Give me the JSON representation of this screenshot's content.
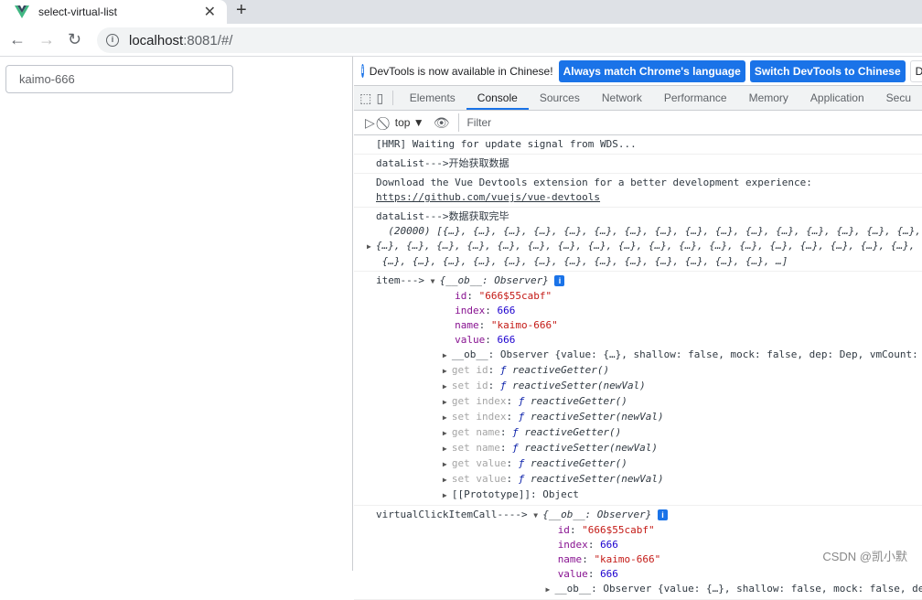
{
  "browser": {
    "tab_title": "select-virtual-list",
    "url_host": "localhost",
    "url_path": ":8081/#/"
  },
  "page": {
    "input_value": "kaimo-666"
  },
  "devtools": {
    "info_message": "DevTools is now available in Chinese!",
    "btn_match": "Always match Chrome's language",
    "btn_switch": "Switch DevTools to Chinese",
    "btn_dont": "Don't",
    "tabs": [
      "Elements",
      "Console",
      "Sources",
      "Network",
      "Performance",
      "Memory",
      "Application",
      "Secu"
    ],
    "active_tab": "Console",
    "context": "top ▼",
    "filter_placeholder": "Filter"
  },
  "console": {
    "hmr": "[HMR] Waiting for update signal from WDS...",
    "start": "dataList--->开始获取数据",
    "download": "Download the Vue Devtools extension for a better development experience:",
    "download_link": "https://github.com/vuejs/vue-devtools",
    "done": "dataList--->数据获取完毕",
    "array_line1": "(20000) [{…}, {…}, {…}, {…}, {…}, {…}, {…}, {…}, {…}, {…}, {…}, {…}, {…}, {…}, {…}, {…},",
    "array_line2": "{…}, {…}, {…}, {…}, {…}, {…}, {…}, {…}, {…}, {…}, {…}, {…}, {…}, {…}, {…}, {…}, {…}, {…},",
    "array_line3": "{…}, {…}, {…}, {…}, {…}, {…}, {…}, {…}, {…}, {…}, {…}, {…}, {…}, …]",
    "item_label": "item--->",
    "virtual_label": "virtualClickItemCall---->",
    "obj_summary": "{__ob__: Observer}",
    "props": [
      {
        "key": "id",
        "value": "\"666$55cabf\"",
        "type": "str"
      },
      {
        "key": "index",
        "value": "666",
        "type": "num"
      },
      {
        "key": "name",
        "value": "\"kaimo-666\"",
        "type": "str"
      },
      {
        "key": "value",
        "value": "666",
        "type": "num"
      }
    ],
    "ob_line": "__ob__: Observer {value: {…}, shallow: false, mock: false, dep: Dep, vmCount: ",
    "accessors": [
      {
        "key": "get id",
        "fn": "reactiveGetter()"
      },
      {
        "key": "set id",
        "fn": "reactiveSetter(newVal)"
      },
      {
        "key": "get index",
        "fn": "reactiveGetter()"
      },
      {
        "key": "set index",
        "fn": "reactiveSetter(newVal)"
      },
      {
        "key": "get name",
        "fn": "reactiveGetter()"
      },
      {
        "key": "set name",
        "fn": "reactiveSetter(newVal)"
      },
      {
        "key": "get value",
        "fn": "reactiveGetter()"
      },
      {
        "key": "set value",
        "fn": "reactiveSetter(newVal)"
      }
    ],
    "prototype": "[[Prototype]]: Object",
    "partial_line": "__ob__: Observer {value: {…}, shallow: false, mock: false, de"
  },
  "watermark": "CSDN @凯小默"
}
